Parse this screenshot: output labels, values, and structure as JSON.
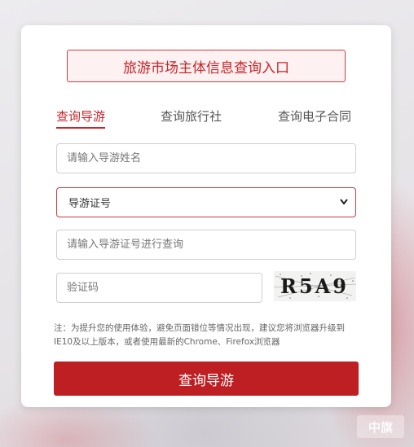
{
  "card": {
    "title": "旅游市场主体信息查询入口",
    "tabs": [
      {
        "label": "查询导游",
        "active": true
      },
      {
        "label": "查询旅行社",
        "active": false
      },
      {
        "label": "查询电子合同",
        "active": false
      }
    ],
    "name_input": {
      "placeholder": "请输入导游姓名",
      "value": ""
    },
    "id_type_select": {
      "selected": "导游证号"
    },
    "id_input": {
      "placeholder": "请输入导游证号进行查询",
      "value": ""
    },
    "captcha_input": {
      "placeholder": "验证码",
      "value": ""
    },
    "captcha_text": "R5A9",
    "note": "注：为提升您的使用体验，避免页面错位等情况出现，建议您将浏览器升级到IE10及以上版本，或者使用最新的Chrome、Firefox浏览器",
    "submit_label": "查询导游"
  },
  "watermark": "中旗",
  "colors": {
    "accent": "#bd1f22",
    "title_bg": "#fdf1f1",
    "active_tab": "#c8242a"
  }
}
